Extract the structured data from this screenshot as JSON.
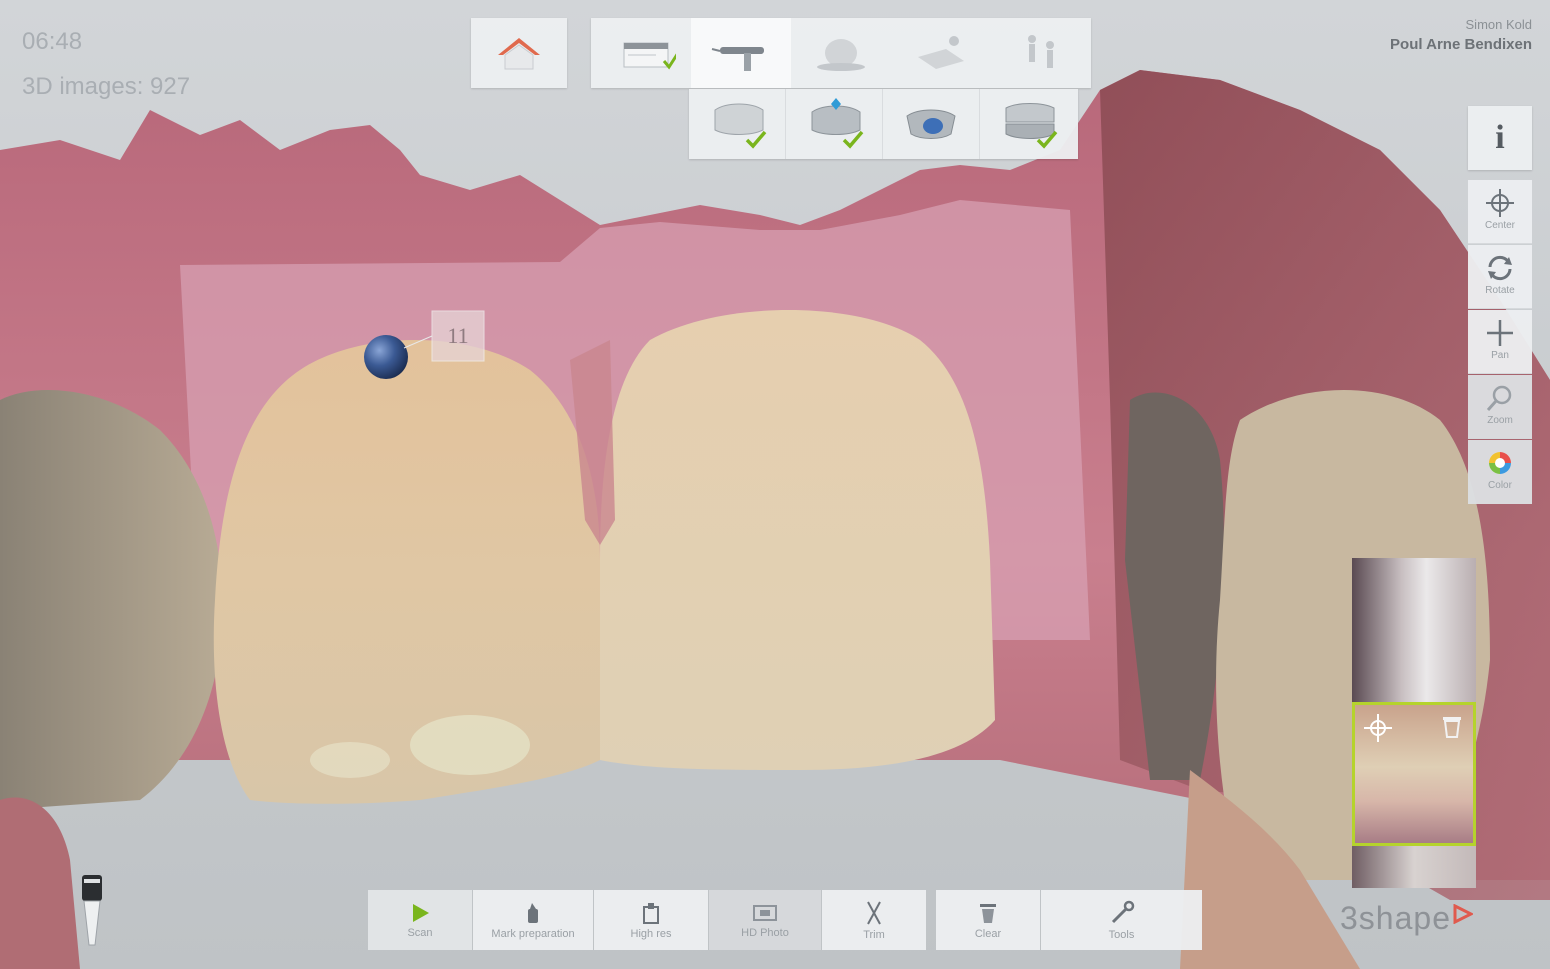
{
  "status": {
    "time": "06:48",
    "images": "3D images: 927"
  },
  "user": {
    "operator": "Simon Kold",
    "patient": "Poul Arne Bendixen"
  },
  "tooth_label": "11",
  "info_label": "i",
  "view_tools": [
    {
      "label": "Center",
      "icon": "center-icon"
    },
    {
      "label": "Rotate",
      "icon": "rotate-icon"
    },
    {
      "label": "Pan",
      "icon": "pan-icon"
    },
    {
      "label": "Zoom",
      "icon": "zoom-icon"
    },
    {
      "label": "Color",
      "icon": "color-icon"
    }
  ],
  "bottom_toolbar": [
    {
      "label": "Scan",
      "icon": "play-icon"
    },
    {
      "label": "Mark preparation",
      "icon": "mark-preparation-icon"
    },
    {
      "label": "High res",
      "icon": "high-res-icon"
    },
    {
      "label": "HD Photo",
      "icon": "hd-photo-icon"
    },
    {
      "label": "Trim",
      "icon": "scissors-icon"
    },
    {
      "label": "Clear",
      "icon": "trash-icon"
    },
    {
      "label": "Tools",
      "icon": "wrench-icon"
    }
  ],
  "brand": {
    "text": "3shape",
    "accent": "#e05a4e"
  },
  "colors": {
    "check": "#7ab51d",
    "thumb_border": "#b5d32c",
    "home": "#e06a4e"
  }
}
